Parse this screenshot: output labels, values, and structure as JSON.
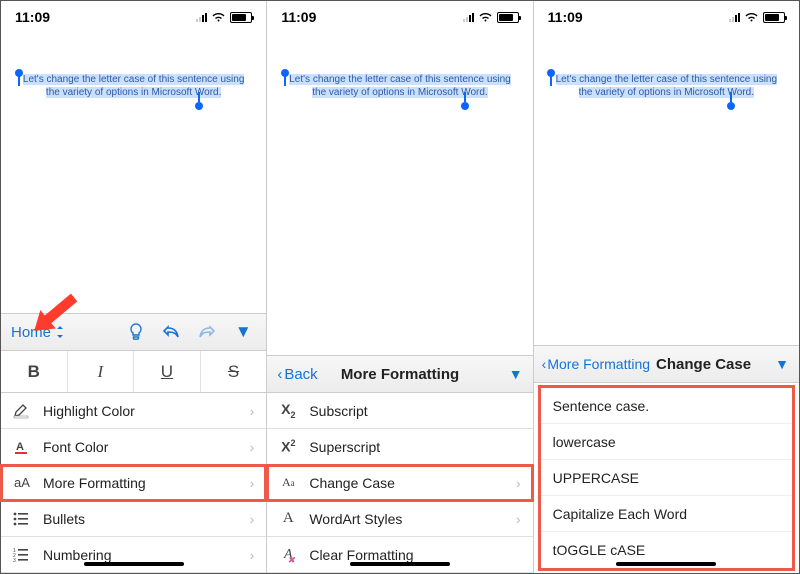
{
  "status": {
    "time": "11:09"
  },
  "document": {
    "selected_text": "Let's change the letter case of this sentence using the variety of options in Microsoft Word."
  },
  "panel1": {
    "toolbar": {
      "home": "Home"
    },
    "format_buttons": {
      "bold": "B",
      "italic": "I",
      "underline": "U",
      "strike": "S"
    },
    "rows": {
      "highlight_color": "Highlight Color",
      "font_color": "Font Color",
      "more_formatting": "More Formatting",
      "bullets": "Bullets",
      "numbering": "Numbering"
    }
  },
  "panel2": {
    "back": "Back",
    "title": "More Formatting",
    "rows": {
      "subscript": "Subscript",
      "superscript": "Superscript",
      "change_case": "Change Case",
      "wordart": "WordArt Styles",
      "clear": "Clear Formatting"
    }
  },
  "panel3": {
    "back": "More Formatting",
    "title": "Change Case",
    "options": {
      "sentence": "Sentence case.",
      "lowercase": "lowercase",
      "uppercase": "UPPERCASE",
      "capitalize": "Capitalize Each Word",
      "toggle": "tOGGLE cASE"
    }
  }
}
